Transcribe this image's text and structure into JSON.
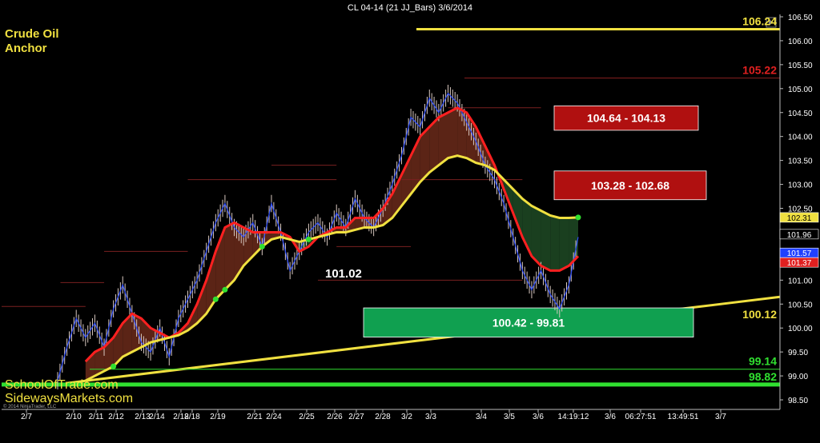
{
  "window": {
    "title": "CL 04-14 (21 JJ_Bars)  3/6/2014"
  },
  "branding": {
    "title_line1": "Crude Oil",
    "title_line2": "Anchor",
    "url1": "SchoolOfTrade.com",
    "url2": "SidewaysMarkets.com",
    "copyright": "© 2014 NinjaTrader, LLC"
  },
  "chart_data": {
    "type": "line",
    "symbol": "CL 04-14",
    "bar_type": "21 JJ_Bars",
    "ylim": [
      98.3,
      106.55
    ],
    "y_ticks": [
      "106.50",
      "106.00",
      "105.50",
      "105.00",
      "104.50",
      "104.00",
      "103.50",
      "103.00",
      "102.50",
      "102.00",
      "101.50",
      "101.00",
      "100.50",
      "100.00",
      "99.50",
      "99.00",
      "98.50"
    ],
    "x_ticks": [
      "2/7",
      "2/10",
      "2/11",
      "2/12",
      "2/13",
      "2/14",
      "2/18",
      "2/18",
      "2/19",
      "2/21",
      "2/24",
      "2/25",
      "2/26",
      "2/27",
      "2/28",
      "3/2",
      "3/3",
      "3/4",
      "3/5",
      "3/6",
      "14:19:12",
      "3/6",
      "06:27:51",
      "13:49:51",
      "3/7"
    ],
    "price": [
      98.9,
      99.6,
      100.2,
      99.8,
      100.1,
      99.6,
      100.4,
      100.9,
      100.3,
      99.7,
      99.5,
      100.0,
      99.4,
      100.2,
      100.6,
      101.0,
      101.6,
      102.2,
      102.6,
      102.1,
      101.9,
      102.2,
      101.7,
      102.6,
      102.0,
      101.2,
      101.6,
      102.0,
      102.2,
      101.9,
      102.4,
      102.1,
      102.7,
      102.3,
      102.1,
      102.5,
      103.0,
      103.6,
      104.4,
      104.2,
      104.8,
      104.5,
      104.9,
      104.7,
      104.3,
      103.9,
      103.4,
      103.1,
      102.6,
      101.9,
      101.2,
      100.8,
      101.2,
      100.7,
      100.4,
      100.9,
      101.9
    ],
    "series": [
      {
        "name": "",
        "role": "fast_ma",
        "color": "#ff2020",
        "values": [
          null,
          null,
          null,
          99.3,
          99.5,
          99.6,
          99.8,
          100.1,
          100.3,
          100.2,
          100.0,
          99.9,
          99.8,
          99.9,
          100.1,
          100.5,
          101.0,
          101.6,
          102.1,
          102.2,
          102.1,
          102.0,
          102.0,
          102.0,
          102.0,
          101.9,
          101.6,
          101.7,
          101.9,
          102.0,
          102.1,
          102.1,
          102.3,
          102.3,
          102.3,
          102.5,
          102.8,
          103.2,
          103.6,
          104.0,
          104.2,
          104.4,
          104.5,
          104.6,
          104.5,
          104.2,
          103.8,
          103.4,
          102.9,
          102.4,
          101.9,
          101.5,
          101.3,
          101.2,
          101.2,
          101.3,
          101.5
        ]
      },
      {
        "name": "",
        "role": "slow_ma",
        "color": "#f0e040",
        "values": [
          null,
          null,
          null,
          98.9,
          99.0,
          99.1,
          99.2,
          99.4,
          99.5,
          99.6,
          99.7,
          99.75,
          99.8,
          99.85,
          99.95,
          100.1,
          100.3,
          100.6,
          100.8,
          101.0,
          101.3,
          101.5,
          101.7,
          101.85,
          101.9,
          101.85,
          101.8,
          101.85,
          101.9,
          101.95,
          102.0,
          102.0,
          102.05,
          102.1,
          102.1,
          102.15,
          102.3,
          102.55,
          102.8,
          103.05,
          103.25,
          103.4,
          103.55,
          103.6,
          103.55,
          103.45,
          103.4,
          103.3,
          103.1,
          102.9,
          102.7,
          102.55,
          102.45,
          102.35,
          102.3,
          102.3,
          102.31
        ]
      }
    ],
    "level_lines": [
      {
        "label": "106.24",
        "value": 106.24,
        "color": "#f0e040"
      },
      {
        "label": "105.22",
        "value": 105.22,
        "color": "#e02020"
      },
      {
        "label": "100.12",
        "value": 100.12,
        "color": "#f0e040"
      },
      {
        "label": "99.14",
        "value": 99.14,
        "color": "#30e030"
      },
      {
        "label": "98.82",
        "value": 98.82,
        "color": "#30e030"
      }
    ],
    "zones": [
      {
        "label": "104.64 - 104.13",
        "high": 104.64,
        "low": 104.13,
        "color": "#b01010"
      },
      {
        "label": "103.28 - 102.68",
        "high": 103.28,
        "low": 102.68,
        "color": "#b01010"
      },
      {
        "label": "100.42 - 99.81",
        "high": 100.42,
        "low": 99.81,
        "color": "#10a050"
      }
    ],
    "annotations": [
      {
        "label": "101.02",
        "value": 101.02
      }
    ],
    "trendline": {
      "from": [
        1,
        98.85
      ],
      "to": [
        59,
        100.65
      ],
      "color": "#f0e040"
    },
    "price_tags": [
      {
        "label": "102.31",
        "color": "#f0e040",
        "text_color": "#000000"
      },
      {
        "label": "101.96",
        "color": "#000000",
        "text_color": "#ffffff"
      },
      {
        "label": "101.57",
        "color": "#2040ff",
        "text_color": "#ffffff"
      },
      {
        "label": "101.37",
        "color": "#e02020",
        "text_color": "#ffffff"
      }
    ],
    "green_dots": [
      6,
      17,
      18,
      22,
      27,
      56
    ]
  }
}
